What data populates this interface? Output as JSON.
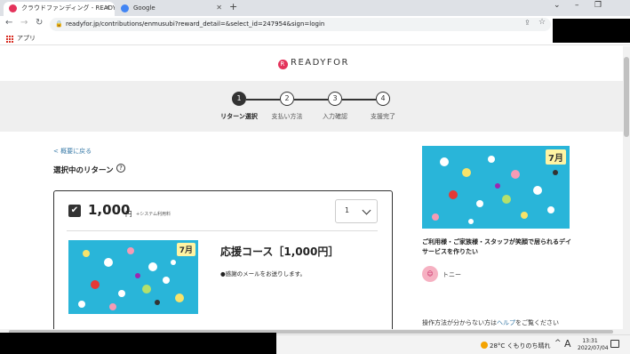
{
  "browser": {
    "tabs": [
      {
        "title": "クラウドファンディング - READYFOR (",
        "favicon_color": "#e4335b",
        "close": "✕"
      },
      {
        "title": "Google",
        "favicon_color": "#4285f4",
        "close": "✕"
      }
    ],
    "new_tab": "+",
    "window_controls": {
      "collapse": "⌄",
      "minimize": "–",
      "maximize": "❐",
      "close": "✕"
    },
    "address": "readyfor.jp/contributions/enmusubi?reward_detail=&select_id=247954&sign=login",
    "bookmarks_label": "アプリ"
  },
  "site": {
    "logo": "READYFOR",
    "logo_mark": "R"
  },
  "steps": [
    {
      "num": "1",
      "label": "リターン選択",
      "active": true
    },
    {
      "num": "2",
      "label": "支払い方法",
      "active": false
    },
    {
      "num": "3",
      "label": "入力確認",
      "active": false
    },
    {
      "num": "4",
      "label": "支援完了",
      "active": false
    }
  ],
  "main": {
    "back_link": "< 概要に戻る",
    "selected_heading": "選択中のリターン",
    "help_icon": "?",
    "reward": {
      "checked": "✔",
      "price": "1,000",
      "currency": "円",
      "fee_note": "+システム利用料",
      "quantity": "1",
      "course_title": "応援コース［1,000円］",
      "description": "●感謝のメールをお送りします。",
      "image_badge": "7月"
    }
  },
  "sidebar": {
    "image_badge": "7月",
    "project_title": "ご利用様・ご家族様・スタッフが笑顔で居られるデイサービスを作りたい",
    "owner_name": "トニー",
    "help_prefix": "操作方法が分からない方は",
    "help_link": "ヘルプ",
    "help_suffix": "をご覧ください"
  },
  "taskbar": {
    "weather": "28°C  くもりのち晴れ",
    "caret": "^",
    "ime": "A",
    "time": "13:31",
    "date": "2022/07/04"
  },
  "colors": {
    "brand": "#e4335b",
    "link": "#3a7ba8",
    "image_bg": "#29b5d9"
  }
}
